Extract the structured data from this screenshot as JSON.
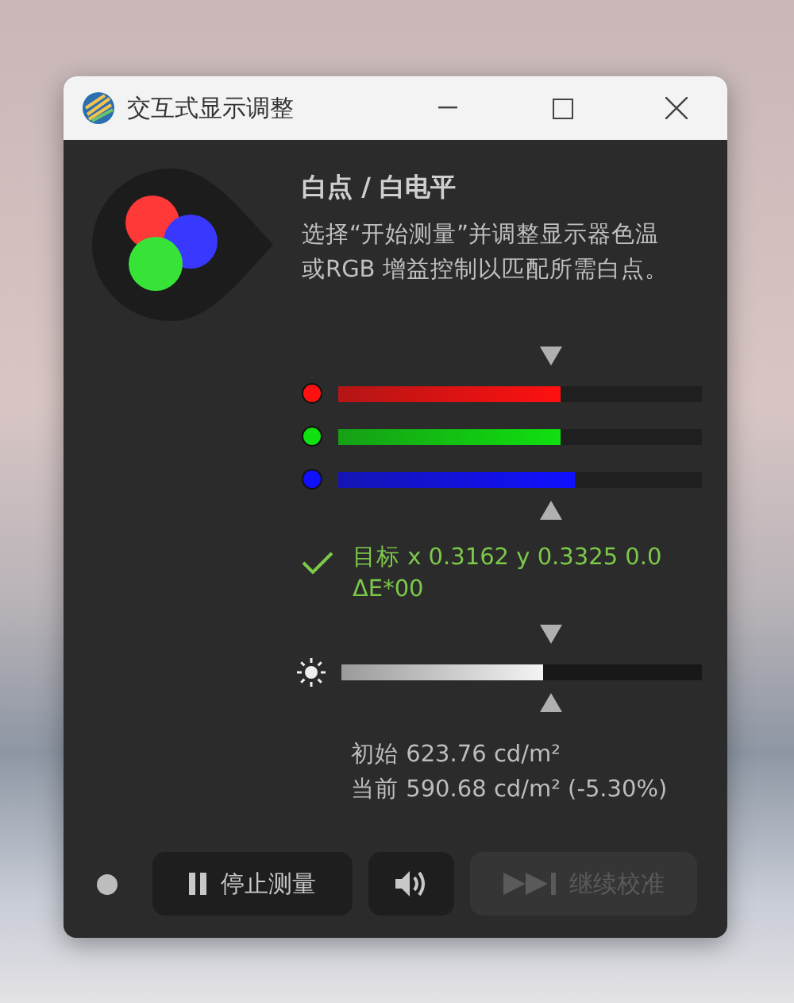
{
  "window": {
    "title": "交互式显示调整"
  },
  "heading": "白点 / 白电平",
  "description": "选择“开始测量”并调整显示器色温或RGB 增益控制以匹配所需白点。",
  "channels": [
    {
      "color": "#ff1010",
      "level": 0.61
    },
    {
      "color": "#10e010",
      "level": 0.61
    },
    {
      "color": "#1010ff",
      "level": 0.65
    }
  ],
  "status": {
    "ok": true,
    "text": "目标 x 0.3162 y 0.3325 0.0 ΔE*00"
  },
  "brightness": {
    "level": 0.56
  },
  "readings": [
    "初始 623.76 cd/m²",
    "当前 590.68 cd/m² (-5.30%)"
  ],
  "buttons": [
    {
      "kind": "pause",
      "label": "停止测量",
      "disabled": false
    },
    {
      "kind": "sound",
      "disabled": false
    },
    {
      "kind": "skip",
      "label": "继续校准",
      "disabled": true
    }
  ]
}
